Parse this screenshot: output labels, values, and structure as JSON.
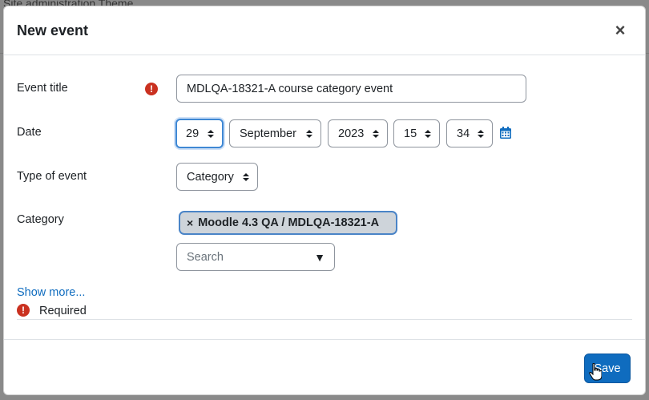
{
  "background": {
    "breadcrumb_text": "Site administration   Theme"
  },
  "modal": {
    "title": "New event",
    "close_label": "×"
  },
  "form": {
    "event_title": {
      "label": "Event title",
      "value": "MDLQA-18321-A course category event"
    },
    "date": {
      "label": "Date",
      "day": "29",
      "month": "September",
      "year": "2023",
      "hour": "15",
      "minute": "34"
    },
    "type_of_event": {
      "label": "Type of event",
      "value": "Category"
    },
    "category": {
      "label": "Category",
      "selected_tag": "Moodle 4.3 QA / MDLQA-18321-A",
      "tag_remove": "×",
      "search_placeholder": "Search"
    },
    "show_more": "Show more...",
    "required_label": "Required",
    "required_icon": "!"
  },
  "footer": {
    "save_label": "Save"
  },
  "colors": {
    "primary": "#0f6cbf",
    "required": "#ca3120",
    "focus": "#3f88d4"
  },
  "icons": {
    "required": "exclamation-circle-icon",
    "calendar": "calendar-icon",
    "close": "close-icon",
    "dropdown": "sort-arrows-icon"
  }
}
